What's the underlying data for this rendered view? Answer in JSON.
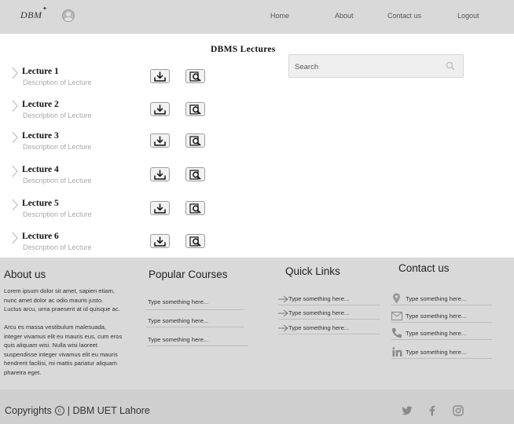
{
  "header": {
    "logo": "DBM",
    "nav": [
      {
        "label": "Home"
      },
      {
        "label": "About"
      },
      {
        "label": "Contact us"
      },
      {
        "label": "Logout"
      }
    ]
  },
  "main": {
    "title": "DBMS  Lectures",
    "lectures": [
      {
        "title": "Lecture 1",
        "description": "Description of Lecture"
      },
      {
        "title": "Lecture 2",
        "description": "Description of Lecture"
      },
      {
        "title": "Lecture 3",
        "description": "Description of Lecture"
      },
      {
        "title": "Lecture 4",
        "description": "Description of Lecture"
      },
      {
        "title": "Lecture 5",
        "description": "Description of Lecture"
      },
      {
        "title": "Lecture 6",
        "description": "Description of Lecture"
      }
    ],
    "search": {
      "placeholder": "Search",
      "value": ""
    }
  },
  "footer": {
    "about": {
      "heading": "About us",
      "para1": "Lorem ipsum dolor sit amet, sapien etiam, nunc amet dolor ac odio mauris justo. Luctus arcu, urna praesent at id quisque ac.",
      "para2": "Arcu es massa vestibulum malesuada, integer vivamus elit eu mauris eus, cum eros quis aliquam wisi. Nulla wisi laoreet suspendisse integer vivamus elit eu mauris hendrerit facilisi, mi mattis pariatur aliquam pharetra eget."
    },
    "courses": {
      "heading": "Popular Courses",
      "items": [
        "Type something here...",
        "Type something here...",
        "Type something here..."
      ]
    },
    "links": {
      "heading": "Quick Links",
      "items": [
        "Type something here...",
        "Type something here...",
        "Type something here..."
      ]
    },
    "contact": {
      "heading": "Contact us",
      "items": [
        {
          "icon": "location-pin-icon",
          "text": "Type something here..."
        },
        {
          "icon": "envelope-icon",
          "text": "Type something here..."
        },
        {
          "icon": "phone-icon",
          "text": "Type something here..."
        },
        {
          "icon": "linkedin-icon",
          "text": "Type something here..."
        }
      ]
    }
  },
  "bottom": {
    "copyright_prefix": "Copyrights",
    "copyright_symbol": "c",
    "copyright_suffix": "| DBM UET Lahore",
    "social": [
      "twitter-icon",
      "facebook-icon",
      "instagram-icon"
    ]
  }
}
